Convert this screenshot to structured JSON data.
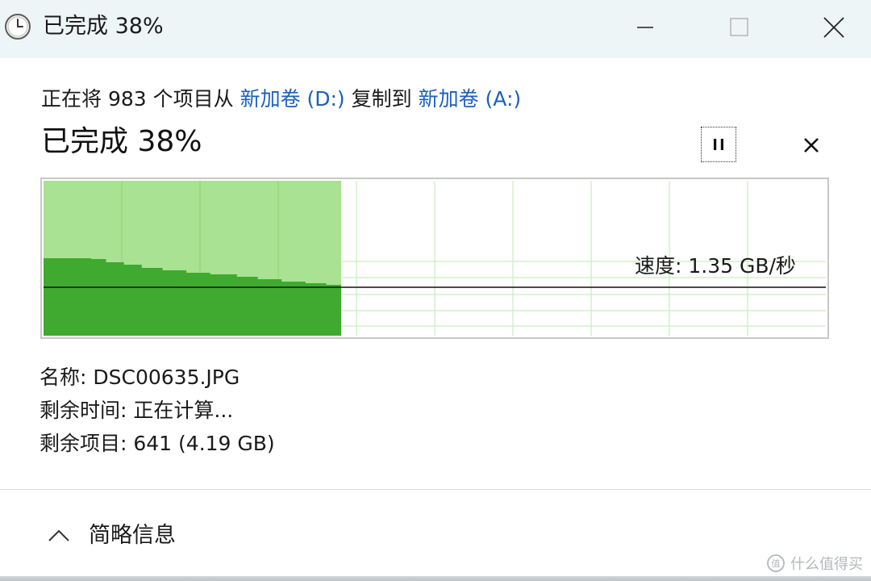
{
  "window": {
    "title": "已完成 38%",
    "controls": {
      "minimize_icon": "minimize-icon",
      "maximize_icon": "maximize-icon",
      "close_icon": "close-icon"
    }
  },
  "copy_status": {
    "prefix": "正在将 983 个项目从 ",
    "source": "新加卷 (D:)",
    "middle": " 复制到 ",
    "destination": "新加卷 (A:)"
  },
  "progress": {
    "title": "已完成 38%",
    "percent": 38,
    "pause_icon": "pause-icon",
    "cancel_icon": "cancel-icon"
  },
  "speed": {
    "label": "速度: 1.35 GB/秒"
  },
  "details": {
    "name": "名称: DSC00635.JPG",
    "time_remaining": "剩余时间: 正在计算...",
    "items_remaining": "剩余项目: 641 (4.19 GB)"
  },
  "footer": {
    "toggle_label": "简略信息",
    "toggle_icon": "chevron-up-icon"
  },
  "watermark": {
    "text": "什么值得买"
  },
  "colors": {
    "titlebar_bg": "#eef5f7",
    "link": "#1c5fbf",
    "graph_light_fill": "#a9e292",
    "graph_dark_fill": "#3faa2f",
    "graph_grid": "#c9ecc0",
    "graph_border": "#c8c8c8"
  }
}
